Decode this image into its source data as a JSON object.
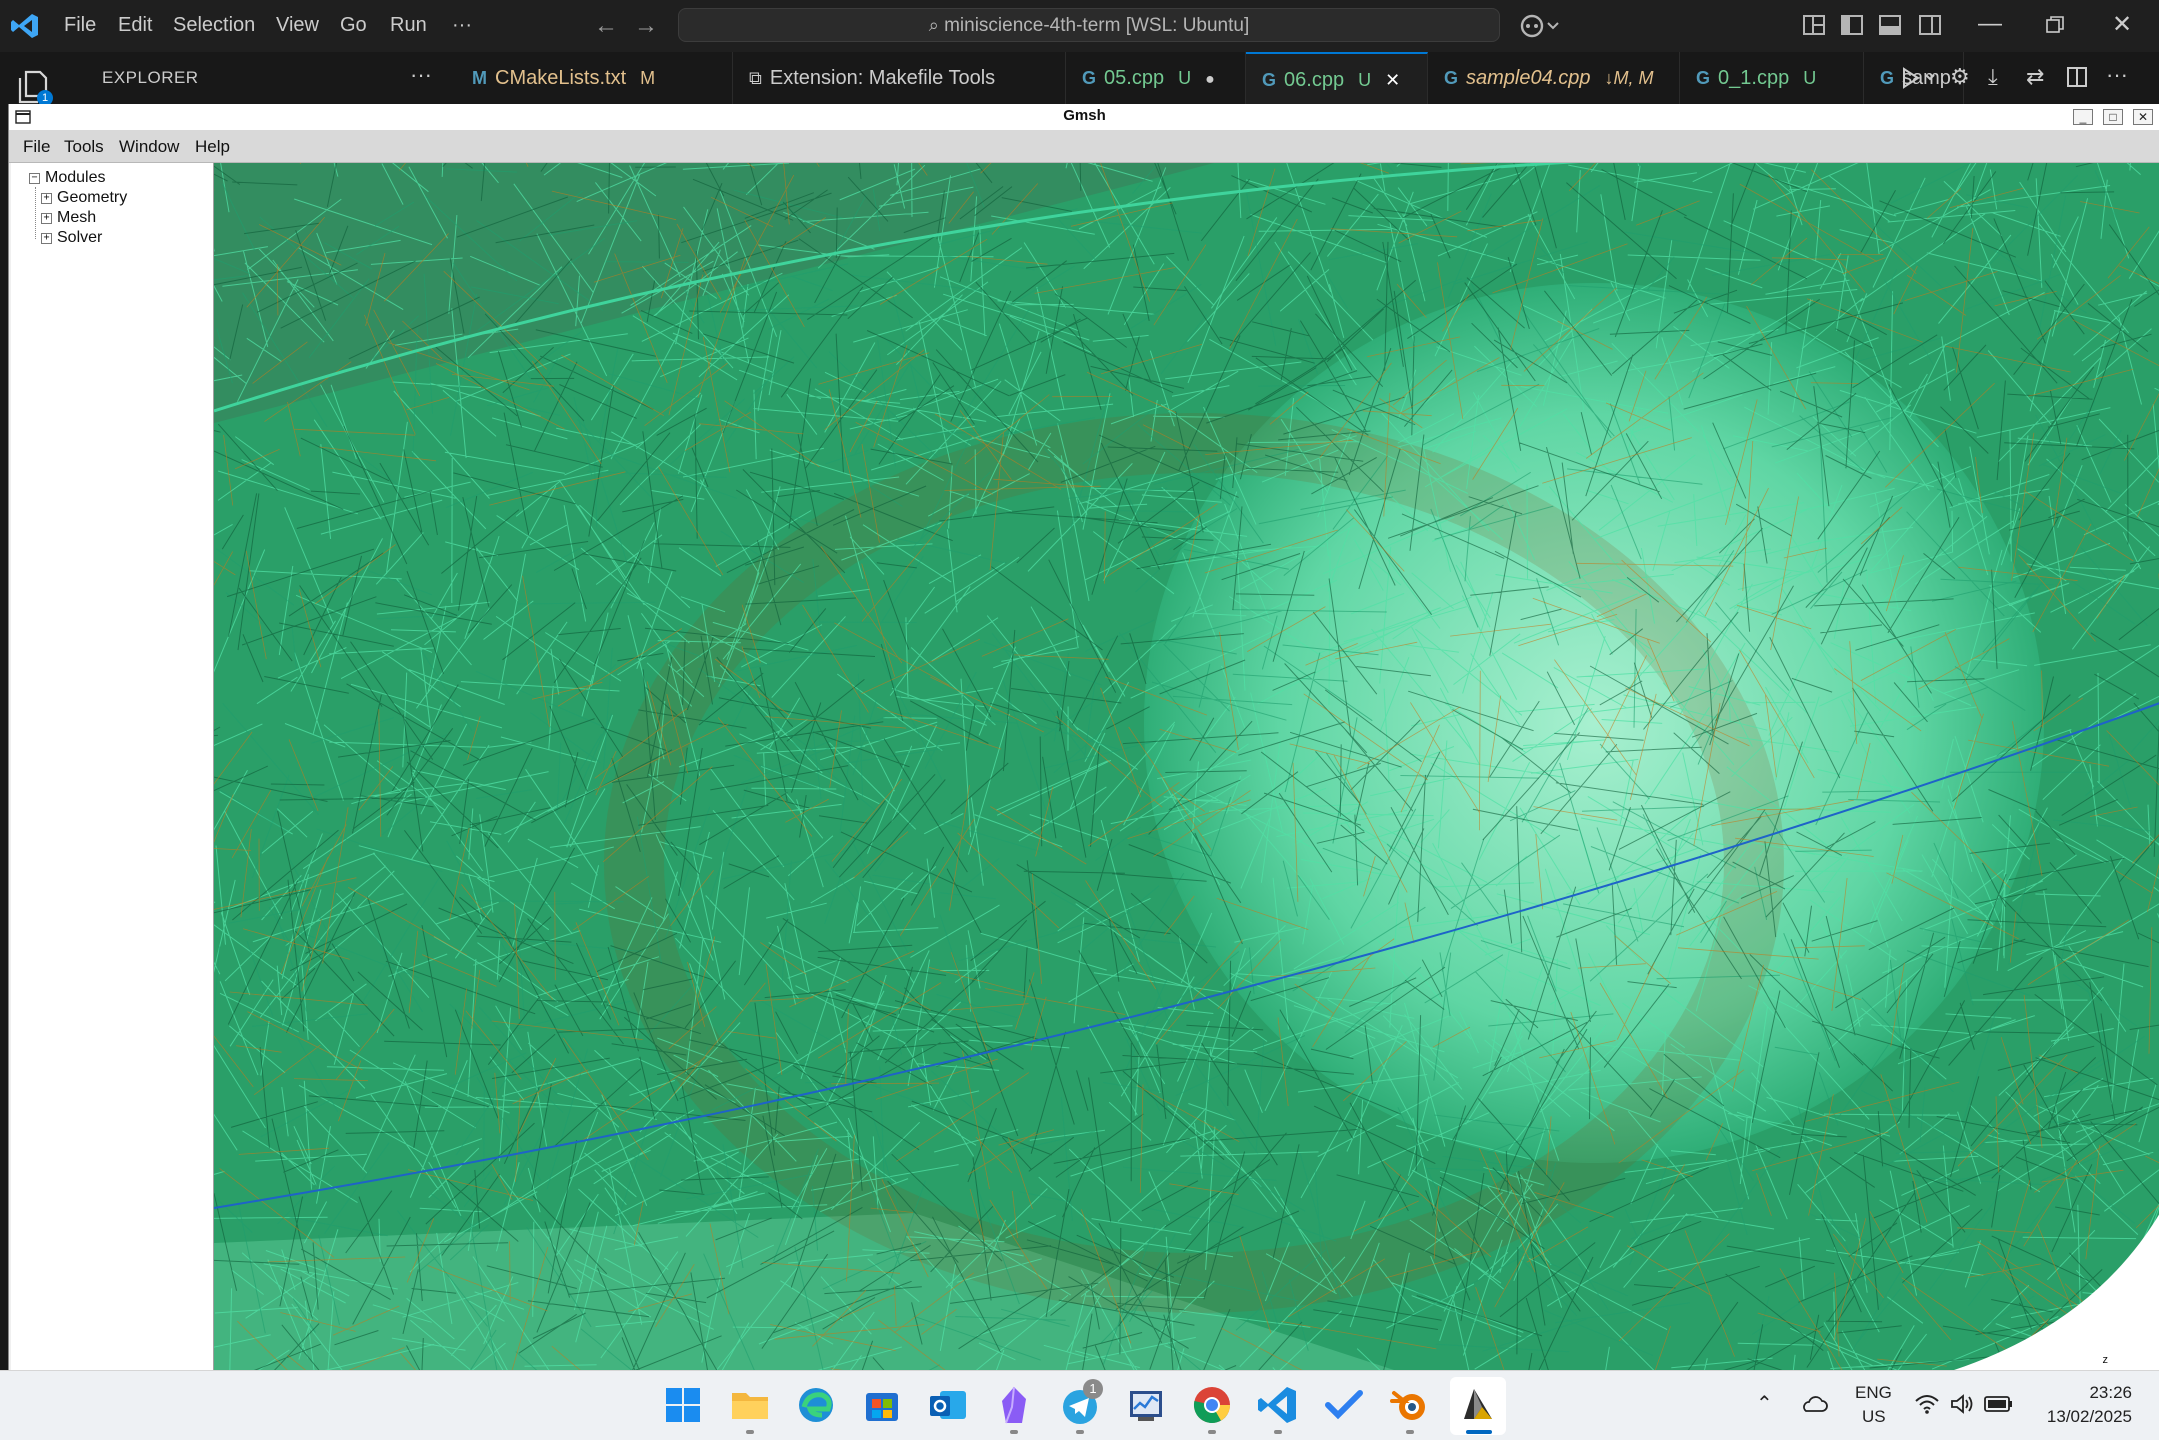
{
  "vscode": {
    "menu": [
      "File",
      "Edit",
      "Selection",
      "View",
      "Go",
      "Run",
      "···"
    ],
    "command_center": "miniscience-4th-term [WSL: Ubuntu]",
    "explorer_label": "EXPLORER",
    "explorer_more": "···",
    "activity_badge": "1",
    "tabs": [
      {
        "label": "CMakeLists.txt",
        "status": "M",
        "icon": "M",
        "color": "#e2c08d"
      },
      {
        "label": "Extension: Makefile Tools",
        "status": "",
        "icon": "⧉",
        "color": "#cccccc"
      },
      {
        "label": "05.cpp",
        "status": "U",
        "icon": "G",
        "color": "#73c991",
        "dirty": "●"
      },
      {
        "label": "06.cpp",
        "status": "U",
        "icon": "G",
        "color": "#73c991",
        "close": "✕"
      },
      {
        "label": "sample04.cpp",
        "status": "↓M, M",
        "icon": "G",
        "color": "#e2c08d"
      },
      {
        "label": "0_1.cpp",
        "status": "U",
        "icon": "G",
        "color": "#73c991"
      },
      {
        "label": "samp",
        "status": "",
        "icon": "G",
        "color": "#cccccc"
      }
    ]
  },
  "gmsh": {
    "title": "Gmsh",
    "menu": [
      "File",
      "Tools",
      "Window",
      "Help"
    ],
    "tree": {
      "root": "Modules",
      "children": [
        "Geometry",
        "Mesh",
        "Solver"
      ]
    },
    "axis_label": "z",
    "mesh_colors": {
      "primary": "#1f9e6e",
      "light": "#52e0a6",
      "dark": "#0f5e38",
      "accent": "#c77a1a",
      "edge": "#1e63c8"
    }
  },
  "taskbar": {
    "apps": [
      "start-icon",
      "file-explorer-icon",
      "edge-icon",
      "store-icon",
      "outlook-icon",
      "obsidian-icon",
      "telegram-icon",
      "taskmanager-icon",
      "chrome-icon",
      "vscode-icon",
      "todo-icon",
      "blender-icon",
      "gmsh-icon"
    ],
    "telegram_badge": "1",
    "lang_line1": "ENG",
    "lang_line2": "US",
    "time": "23:26",
    "date": "13/02/2025"
  }
}
